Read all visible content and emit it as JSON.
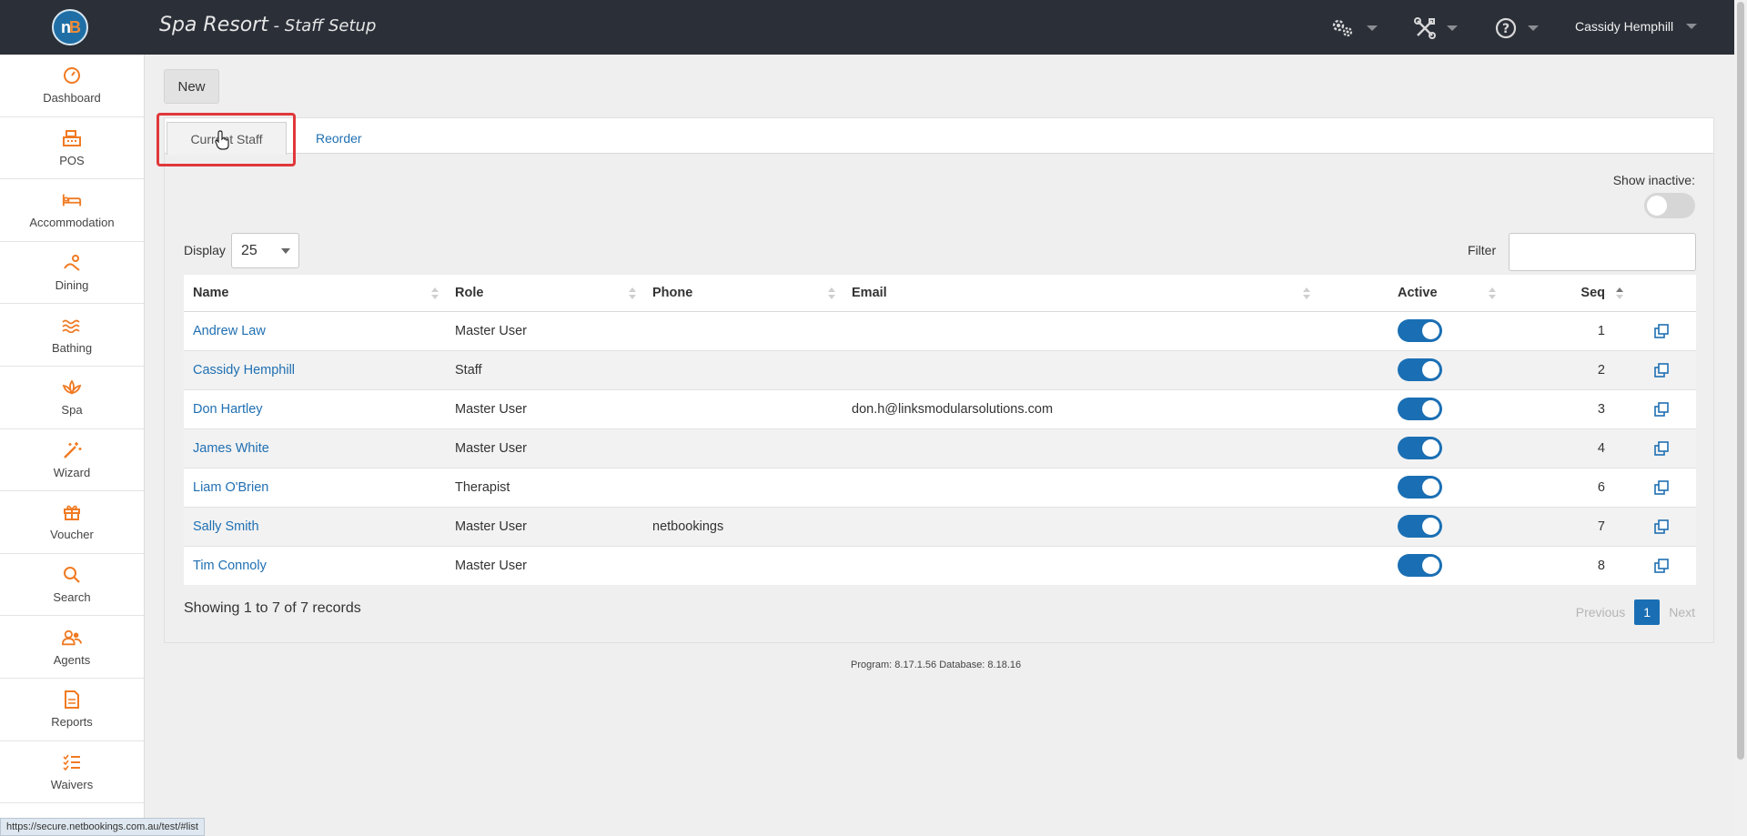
{
  "header": {
    "app_title": "Spa Resort",
    "app_subtitle": " - Staff Setup",
    "user_name": "Cassidy Hemphill",
    "settings_icon": "gears-icon",
    "tools_icon": "tools-icon",
    "help_icon": "help-icon"
  },
  "sidebar": {
    "items": [
      {
        "label": "Dashboard",
        "icon": "dashboard-icon"
      },
      {
        "label": "POS",
        "icon": "cash-register-icon"
      },
      {
        "label": "Accommodation",
        "icon": "bed-icon"
      },
      {
        "label": "Dining",
        "icon": "dining-icon"
      },
      {
        "label": "Bathing",
        "icon": "water-icon"
      },
      {
        "label": "Spa",
        "icon": "lotus-icon"
      },
      {
        "label": "Wizard",
        "icon": "magic-wand-icon"
      },
      {
        "label": "Voucher",
        "icon": "gift-icon"
      },
      {
        "label": "Search",
        "icon": "search-icon"
      },
      {
        "label": "Agents",
        "icon": "agents-icon"
      },
      {
        "label": "Reports",
        "icon": "report-icon"
      },
      {
        "label": "Waivers",
        "icon": "checklist-icon"
      }
    ]
  },
  "toolbar": {
    "new_label": "New"
  },
  "tabs": {
    "current": "Current Staff",
    "reorder": "Reorder"
  },
  "controls": {
    "show_inactive_label": "Show inactive:",
    "display_label": "Display",
    "display_value": "25",
    "filter_label": "Filter",
    "filter_value": ""
  },
  "table": {
    "columns": [
      "Name",
      "Role",
      "Phone",
      "Email",
      "Active",
      "Seq"
    ],
    "rows": [
      {
        "name": "Andrew Law",
        "role": "Master User",
        "phone": "",
        "email": "",
        "active": true,
        "seq": "1"
      },
      {
        "name": "Cassidy Hemphill",
        "role": "Staff",
        "phone": "",
        "email": "",
        "active": true,
        "seq": "2"
      },
      {
        "name": "Don Hartley",
        "role": "Master User",
        "phone": "",
        "email": "don.h@linksmodularsolutions.com",
        "active": true,
        "seq": "3"
      },
      {
        "name": "James White",
        "role": "Master User",
        "phone": "",
        "email": "",
        "active": true,
        "seq": "4"
      },
      {
        "name": "Liam O'Brien",
        "role": "Therapist",
        "phone": "",
        "email": "",
        "active": true,
        "seq": "6"
      },
      {
        "name": "Sally Smith",
        "role": "Master User",
        "phone": "netbookings",
        "email": "",
        "active": true,
        "seq": "7"
      },
      {
        "name": "Tim Connoly",
        "role": "Master User",
        "phone": "",
        "email": "",
        "active": true,
        "seq": "8"
      }
    ]
  },
  "pagination": {
    "summary": "Showing 1 to 7 of 7 records",
    "previous": "Previous",
    "current": "1",
    "next": "Next"
  },
  "footer": {
    "version": "Program: 8.17.1.56 Database: 8.18.16"
  },
  "status_bar": {
    "url": "https://secure.netbookings.com.au/test/#list"
  },
  "colors": {
    "accent": "#1a6fb4",
    "sidebar_icon": "#f07a22",
    "topbar": "#2b2f38",
    "highlight": "#e0383b"
  }
}
